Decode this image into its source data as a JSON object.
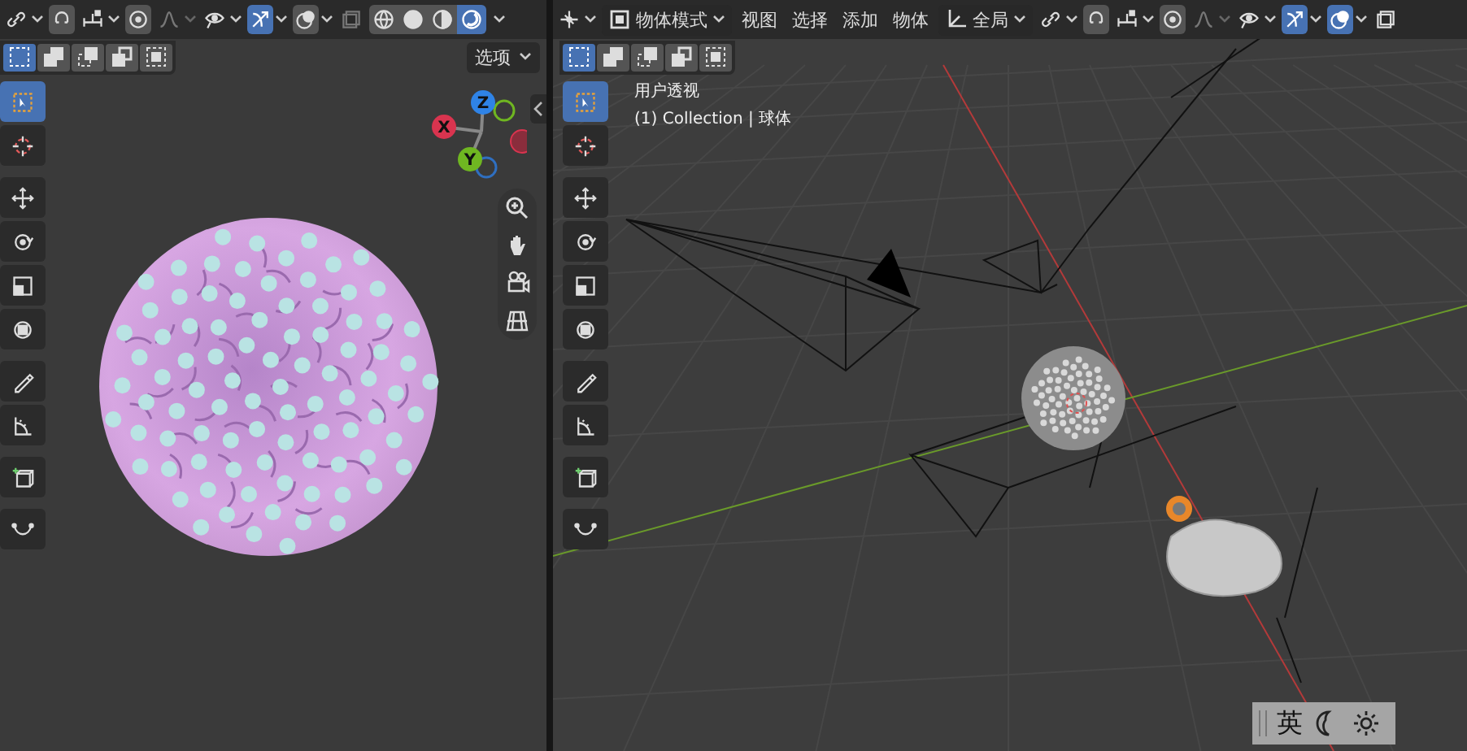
{
  "left_viewport": {
    "header": [
      {
        "kind": "link",
        "dropdown": true
      },
      {
        "kind": "snap",
        "on": false
      },
      {
        "kind": "snap_target",
        "dropdown": true
      },
      {
        "kind": "proportional",
        "on": false
      },
      {
        "kind": "falloff",
        "dropdown": true,
        "disabled": true
      },
      {
        "kind": "visibility",
        "dropdown": true
      },
      {
        "kind": "gizmo",
        "on": true,
        "dropdown": true
      },
      {
        "kind": "overlay",
        "on": false,
        "dropdown": true
      },
      {
        "kind": "xray",
        "disabled": true
      },
      {
        "kind": "shading",
        "modes": [
          {
            "kind": "wireframe",
            "selected": false
          },
          {
            "kind": "solid",
            "selected": false
          },
          {
            "kind": "material",
            "selected": false
          },
          {
            "kind": "rendered",
            "selected": true
          }
        ]
      }
    ],
    "selection_modes": [
      {
        "selected": true
      },
      {
        "selected": false
      },
      {
        "selected": false
      },
      {
        "selected": false
      },
      {
        "selected": false
      }
    ],
    "options_menu": "选项",
    "toolbar": [
      [
        {
          "kind": "select",
          "selected": true
        },
        {
          "kind": "cursor",
          "selected": false
        }
      ],
      [
        {
          "kind": "move",
          "selected": false
        },
        {
          "kind": "rotate",
          "selected": false
        },
        {
          "kind": "scale",
          "selected": false
        },
        {
          "kind": "transform",
          "selected": false
        }
      ],
      [
        {
          "kind": "annotate",
          "selected": false
        },
        {
          "kind": "measure",
          "selected": false
        }
      ],
      [
        {
          "kind": "add_cube",
          "selected": false
        }
      ],
      [
        {
          "kind": "curve",
          "selected": false
        }
      ]
    ],
    "gizmo_axes": [
      {
        "label": "Z",
        "color": "#2f83e6"
      },
      {
        "label": "X",
        "color": "#d9344f"
      },
      {
        "label": "Y",
        "color": "#6fb621"
      }
    ]
  },
  "right_viewport": {
    "header": [
      {
        "kind": "pivot",
        "dropdown": true
      },
      {
        "kind": "mode",
        "label": "物体模式"
      },
      {
        "kind": "menu",
        "label": "视图"
      },
      {
        "kind": "menu",
        "label": "选择"
      },
      {
        "kind": "menu",
        "label": "添加"
      },
      {
        "kind": "menu",
        "label": "物体"
      },
      {
        "kind": "orientation",
        "label": "全局"
      },
      {
        "kind": "link",
        "dropdown": true
      },
      {
        "kind": "snap",
        "on": false
      },
      {
        "kind": "snap_target",
        "dropdown": true
      },
      {
        "kind": "proportional",
        "on": false
      },
      {
        "kind": "falloff",
        "dropdown": true,
        "disabled": true
      },
      {
        "kind": "visibility",
        "dropdown": true
      },
      {
        "kind": "gizmo",
        "on": true,
        "dropdown": true
      },
      {
        "kind": "overlay",
        "on": true,
        "dropdown": true
      },
      {
        "kind": "xray",
        "disabled": false
      }
    ],
    "selection_modes": [
      {
        "selected": true
      },
      {
        "selected": false
      },
      {
        "selected": false
      },
      {
        "selected": false
      },
      {
        "selected": false
      }
    ],
    "view_name": "用户透视",
    "collection_info": "(1) Collection | 球体",
    "toolbar": [
      [
        {
          "kind": "select",
          "selected": true
        },
        {
          "kind": "cursor",
          "selected": false
        }
      ],
      [
        {
          "kind": "move",
          "selected": false
        },
        {
          "kind": "rotate",
          "selected": false
        },
        {
          "kind": "scale",
          "selected": false
        },
        {
          "kind": "transform",
          "selected": false
        }
      ],
      [
        {
          "kind": "annotate",
          "selected": false
        },
        {
          "kind": "measure",
          "selected": false
        }
      ],
      [
        {
          "kind": "add_cube",
          "selected": false
        }
      ],
      [
        {
          "kind": "curve",
          "selected": false
        }
      ]
    ]
  },
  "ime_bar": {
    "language": "英"
  }
}
